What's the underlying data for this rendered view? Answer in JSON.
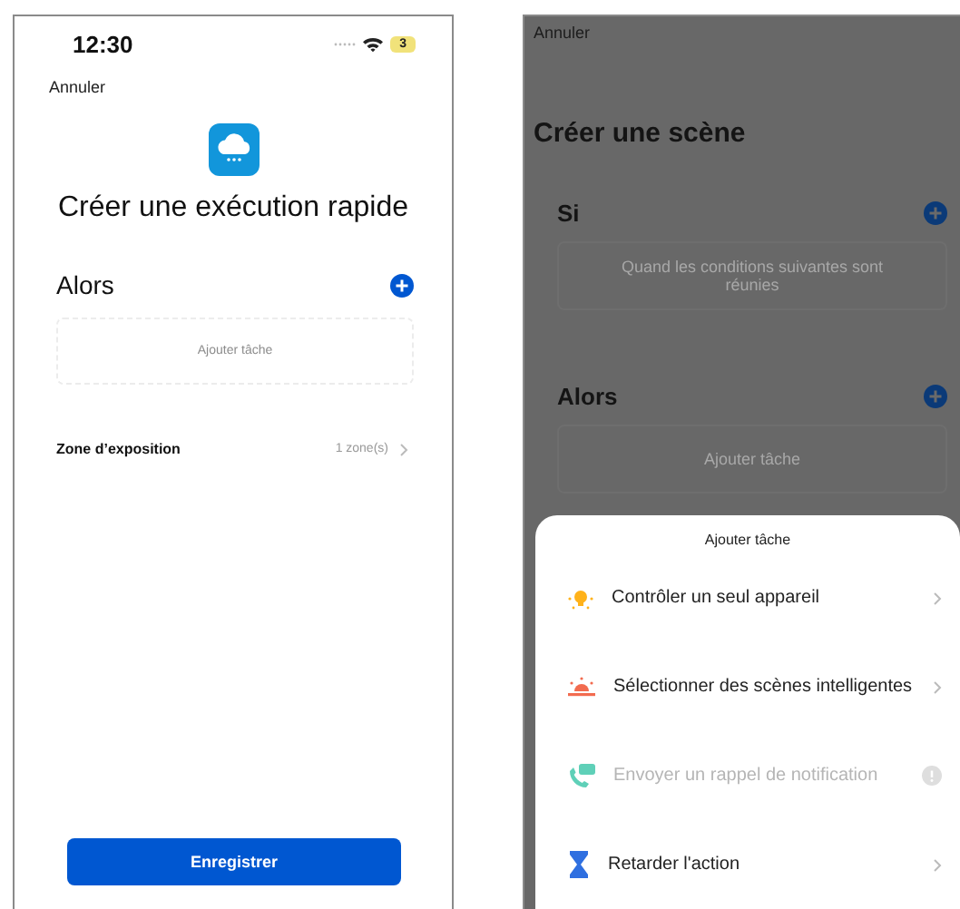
{
  "left_screen": {
    "status_bar": {
      "time": "12:30",
      "battery": "3"
    },
    "cancel": "Annuler",
    "title": "Créer une exécution rapide",
    "then_section": {
      "label": "Alors",
      "hint": "Ajouter tâche"
    },
    "exposure_zone": {
      "label": "Zone d’exposition",
      "value": "1 zone(s)"
    },
    "save_button": "Enregistrer"
  },
  "right_screen": {
    "cancel": "Annuler",
    "title": "Créer une scène",
    "sections": [
      {
        "label": "Si",
        "hint": "Quand les conditions suivantes sont réunies"
      },
      {
        "label": "Alors",
        "hint": "Ajouter tâche"
      }
    ],
    "sheet": {
      "title": "Ajouter tâche",
      "items": [
        {
          "label": "Contrôler un seul appareil",
          "disabled": false
        },
        {
          "label": "Sélectionner des scènes intelligentes",
          "disabled": false
        },
        {
          "label": "Envoyer un rappel de notification",
          "disabled": true
        },
        {
          "label": "Retarder l'action",
          "disabled": false
        }
      ]
    }
  }
}
